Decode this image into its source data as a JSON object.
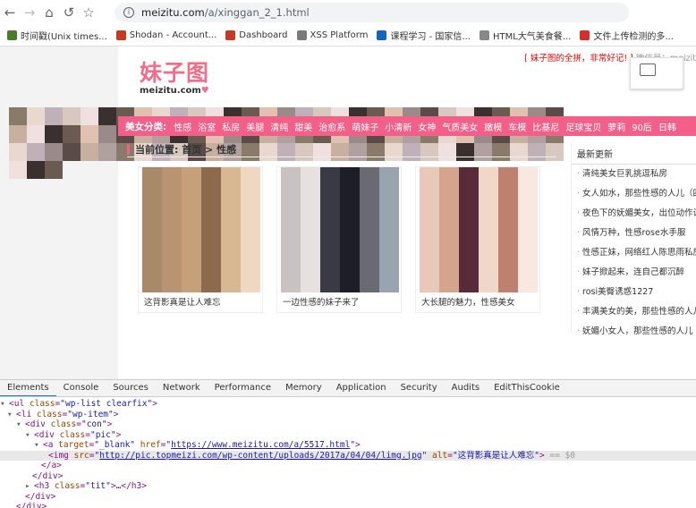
{
  "browser": {
    "url_host": "meizitu.com",
    "url_path": "/a/xinggan_2_1.html"
  },
  "bookmarks": [
    {
      "label": "时间戳(Unix times...",
      "color": "#4a7b2c"
    },
    {
      "label": "Shodan - Account...",
      "color": "#c23b22"
    },
    {
      "label": "Dashboard",
      "color": "#c23b22"
    },
    {
      "label": "XSS Platform",
      "color": "#7a7a7a"
    },
    {
      "label": "课程学习 - 国家信...",
      "color": "#1565c0"
    },
    {
      "label": "HTML大气美食餐...",
      "color": "#888888"
    },
    {
      "label": "文件上传检测的多...",
      "color": "#d32f2f"
    }
  ],
  "site": {
    "logo_cn": "妹子图",
    "logo_en": "meizitu.com",
    "topnote_red": "[ 妹子图的全拼，非常好记! ]",
    "topnote_gray": "微信号：meizit",
    "category_label": "美女分类:",
    "categories": [
      "性感",
      "浴室",
      "私房",
      "美腿",
      "清纯",
      "甜美",
      "治愈系",
      "萌妹子",
      "小清新",
      "女神",
      "气质美女",
      "嫩模",
      "车模",
      "比基尼",
      "足球宝贝",
      "萝莉",
      "90后",
      "日韩"
    ],
    "breadcrumb": "当前位置:  首页 > 性感",
    "cards": [
      {
        "caption": "这背影真是让人难忘"
      },
      {
        "caption": "一边性感的妹子来了"
      },
      {
        "caption": "大长腿的魅力，性感美女"
      }
    ],
    "sidebar_title": "最新更新",
    "sidebar_items": [
      "清纯美女巨乳挑逗私房",
      "女人如水，那些性感的人儿（四）",
      "夜色下的妩媚美女，出位动作让人",
      "风情万种，性感rose水手服",
      "性感正妹，网络红人陈思雨私房照",
      "妹子掀起来，连自己都沉醉",
      "rosi美臀诱惑1227",
      "丰满美女的美，那些性感的人儿",
      "妩媚小女人，那些性感的人儿（"
    ]
  },
  "devtools": {
    "tabs": [
      "Elements",
      "Console",
      "Sources",
      "Network",
      "Performance",
      "Memory",
      "Application",
      "Security",
      "Audits",
      "EditThisCookie"
    ],
    "code": {
      "l1_class": "wp-list clearfix",
      "l2_class": "wp-item",
      "l3_class": "con",
      "l4_class": "pic",
      "l5_target": "_blank",
      "l5_href": "https://www.meizitu.com/a/5517.html",
      "l6_src": "http://pic.topmeizi.com/wp-content/uploads/2017a/04/04/limg.jpg",
      "l6_alt": "这背影真是让人难忘",
      "l6_suffix": "== $0",
      "l9_class": "tit"
    }
  }
}
